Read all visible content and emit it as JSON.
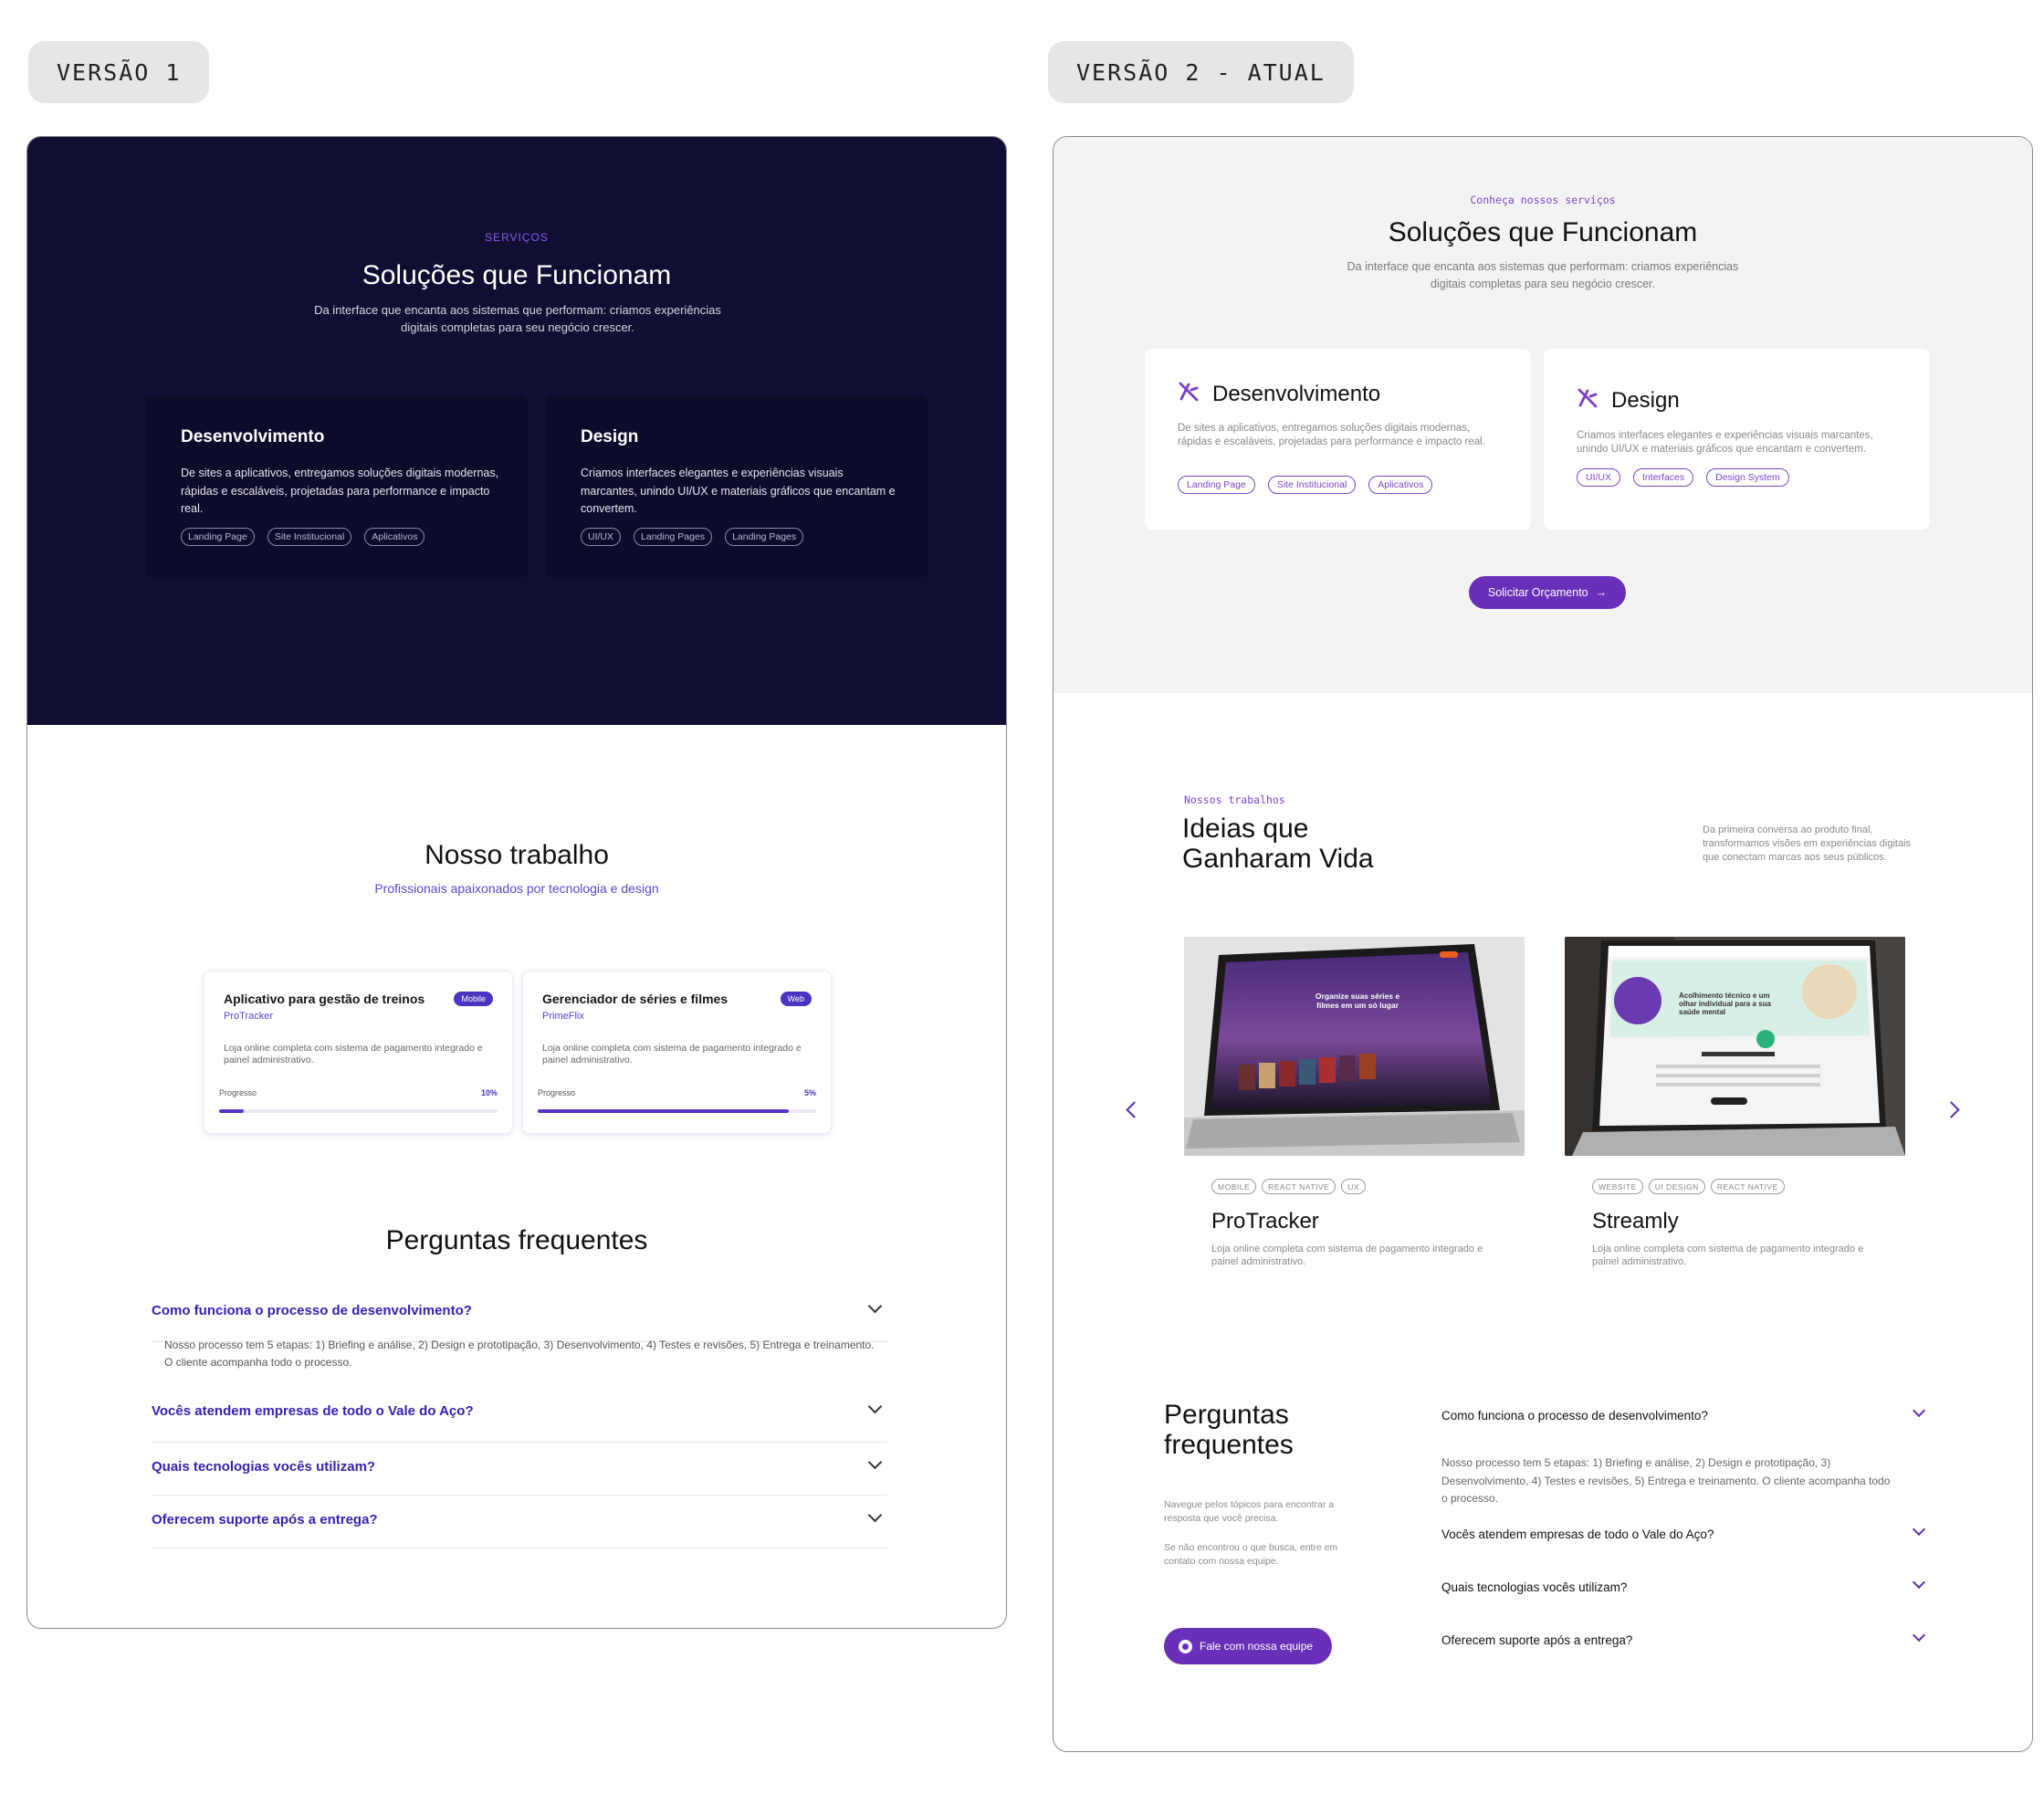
{
  "labels": {
    "v1": "VERSÃO 1",
    "v2": "VERSÃO 2 - ATUAL"
  },
  "v1": {
    "eyebrow": "SERVIÇOS",
    "title": "Soluções que Funcionam",
    "subtitle": "Da interface que encanta aos sistemas que performam: criamos experiências digitais completas para seu negócio crescer.",
    "cards": [
      {
        "title": "Desenvolvimento",
        "desc": "De sites a aplicativos, entregamos soluções digitais modernas, rápidas e escaláveis, projetadas para performance e impacto real.",
        "tags": [
          "Landing Page",
          "Site Institucional",
          "Aplicativos"
        ]
      },
      {
        "title": "Design",
        "desc": "Criamos interfaces elegantes e experiências visuais marcantes, unindo UI/UX e materiais gráficos que encantam e convertem.",
        "tags": [
          "UI/UX",
          "Landing Pages",
          "Landing Pages"
        ]
      }
    ],
    "work": {
      "title": "Nosso trabalho",
      "subtitle": "Profissionais apaixonados por tecnologia e design",
      "projects": [
        {
          "title": "Aplicativo para gestão de treinos",
          "name": "ProTracker",
          "badge": "Mobile",
          "desc": "Loja online completa com sistema de pagamento integrado e painel administrativo.",
          "progress_label": "Progresso",
          "progress_text": "10%",
          "progress": 0.09
        },
        {
          "title": "Gerenciador de séries e filmes",
          "name": "PrimeFlix",
          "badge": "Web",
          "desc": "Loja online completa com sistema de pagamento integrado e painel administrativo.",
          "progress_label": "Progresso",
          "progress_text": "5%",
          "progress": 0.9
        }
      ]
    },
    "faq": {
      "title": "Perguntas frequentes",
      "items": [
        {
          "q": "Como funciona o processo de desenvolvimento?"
        },
        {
          "q": "Vocês atendem empresas de todo o Vale do Aço?"
        },
        {
          "q": "Quais tecnologias vocês utilizam?"
        },
        {
          "q": "Oferecem suporte após a entrega?"
        }
      ],
      "answer": "Nosso processo tem 5 etapas: 1) Briefing e análise, 2) Design e prototipação, 3) Desenvolvimento, 4) Testes e revisões, 5) Entrega e treinamento. O cliente acompanha todo o processo."
    }
  },
  "v2": {
    "eyebrow": "Conheça nossos serviços",
    "title": "Soluções que Funcionam",
    "subtitle": "Da interface que encanta aos sistemas que performam: criamos experiências digitais completas para seu negócio crescer.",
    "cards": [
      {
        "title": "Desenvolvimento",
        "desc": "De sites a aplicativos, entregamos soluções digitais modernas, rápidas e escaláveis, projetadas para performance e impacto real.",
        "tags": [
          "Landing Page",
          "Site Institucional",
          "Aplicativos"
        ]
      },
      {
        "title": "Design",
        "desc": "Criamos interfaces elegantes e experiências visuais marcantes, unindo UI/UX e materiais gráficos que encantam e convertem.",
        "tags": [
          "UI/UX",
          "Interfaces",
          "Design System"
        ]
      }
    ],
    "cta": "Solicitar Orçamento",
    "work": {
      "eyebrow": "Nossos trabalhos",
      "title": "Ideias que Ganharam Vida",
      "desc": "Da primeira conversa ao produto final, transformamos visões em experiências digitais que conectam marcas aos seus públicos.",
      "projects": [
        {
          "title": "ProTracker",
          "tags": [
            "MOBILE",
            "REACT NATIVE",
            "UX"
          ],
          "desc": "Loja online completa com sistema de pagamento integrado e painel administrativo.",
          "screen_headline": "Organize suas séries e filmes em um só lugar"
        },
        {
          "title": "Streamly",
          "tags": [
            "WEBSITE",
            "UI DESIGN",
            "REACT NATIVE"
          ],
          "desc": "Loja online completa com sistema de pagamento integrado e painel administrativo.",
          "screen_headline": "Acolhimento técnico e um olhar individual para a sua saúde mental"
        }
      ]
    },
    "faq": {
      "title": "Perguntas frequentes",
      "p1": "Navegue pelos tópicos para encontrar a resposta que você precisa.",
      "p2": "Se não encontrou o que busca, entre em contato com nossa equipe.",
      "button": "Fale com nossa equipe",
      "items": [
        {
          "q": "Como funciona o processo de desenvolvimento?"
        },
        {
          "q": "Vocês atendem empresas de todo o Vale do Aço?"
        },
        {
          "q": "Quais tecnologias vocês utilizam?"
        },
        {
          "q": "Oferecem suporte após a entrega?"
        }
      ],
      "answer": "Nosso processo tem 5 etapas: 1) Briefing e análise, 2) Design e prototipação, 3) Desenvolvimento, 4) Testes e revisões, 5) Entrega e treinamento. O cliente acompanha todo o processo."
    }
  }
}
